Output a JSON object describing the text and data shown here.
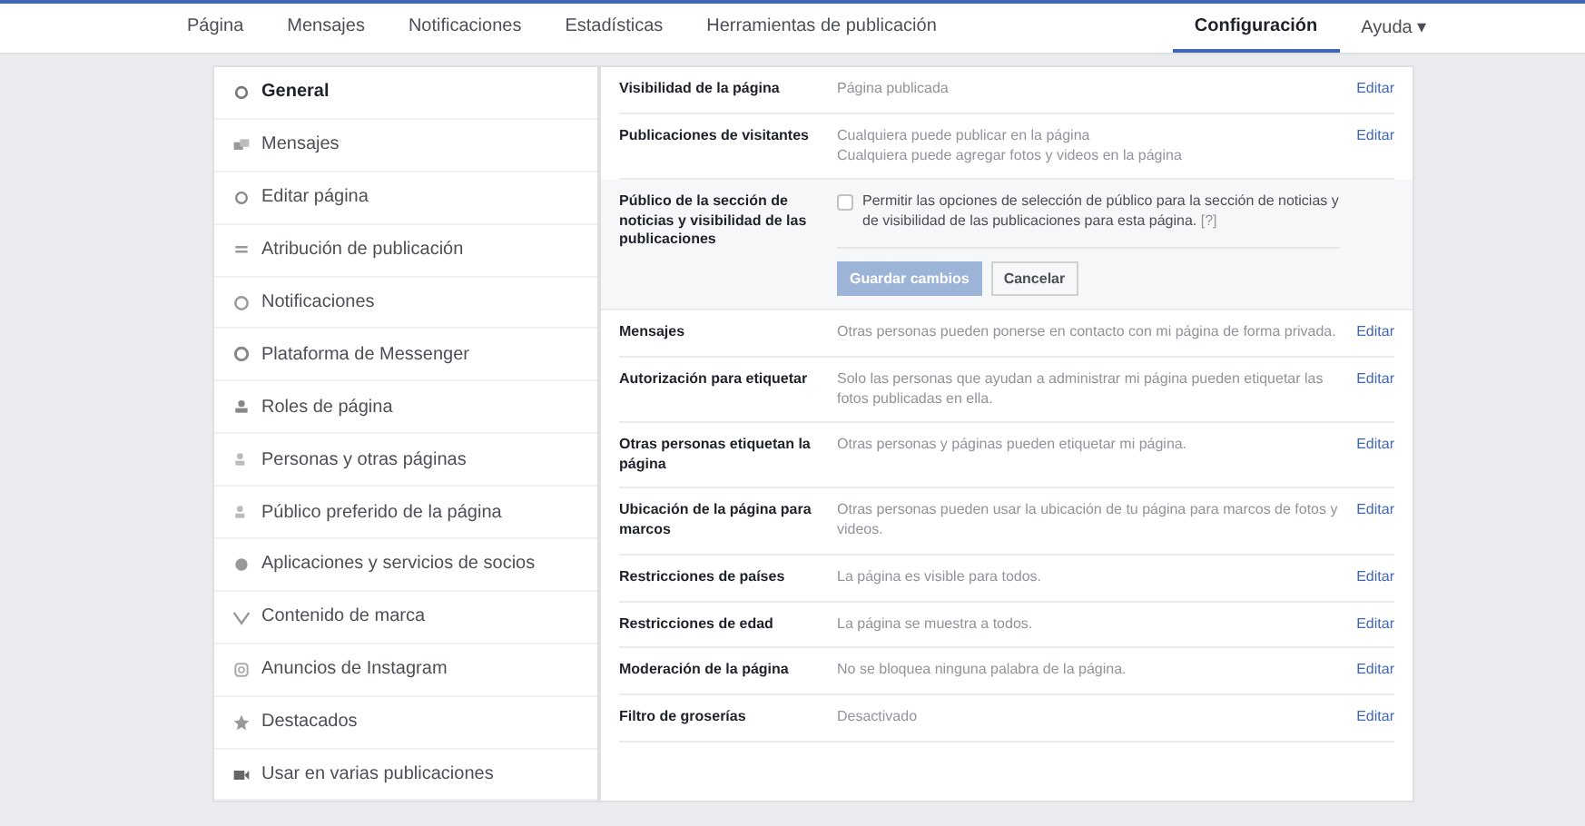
{
  "nav": {
    "tabs": [
      {
        "label": "Página",
        "selected": false
      },
      {
        "label": "Mensajes",
        "selected": false
      },
      {
        "label": "Notificaciones",
        "selected": false
      },
      {
        "label": "Estadísticas",
        "selected": false
      },
      {
        "label": "Herramientas de publicación",
        "selected": false
      },
      {
        "label": "Configuración",
        "selected": true
      },
      {
        "label": "Ayuda ▾",
        "selected": false
      }
    ]
  },
  "sidebar": {
    "items": [
      {
        "label": "General",
        "selected": true
      },
      {
        "label": "Mensajes",
        "selected": false
      },
      {
        "label": "Editar página",
        "selected": false
      },
      {
        "label": "Atribución de publicación",
        "selected": false
      },
      {
        "label": "Notificaciones",
        "selected": false
      },
      {
        "label": "Plataforma de Messenger",
        "selected": false
      },
      {
        "label": "Roles de página",
        "selected": false
      },
      {
        "label": "Personas y otras páginas",
        "selected": false
      },
      {
        "label": "Público preferido de la página",
        "selected": false
      },
      {
        "label": "Aplicaciones y servicios de socios",
        "selected": false
      },
      {
        "label": "Contenido de marca",
        "selected": false
      },
      {
        "label": "Anuncios de Instagram",
        "selected": false
      },
      {
        "label": "Destacados",
        "selected": false
      },
      {
        "label": "Usar en varias publicaciones",
        "selected": false
      }
    ]
  },
  "settings": [
    {
      "kind": "row",
      "label": "Visibilidad de la página",
      "lines": [
        "Página publicada"
      ],
      "action": "Editar"
    },
    {
      "kind": "row",
      "label": "Publicaciones de visitantes",
      "lines": [
        "Cualquiera puede publicar en la página",
        "Cualquiera puede agregar fotos y videos en la página"
      ],
      "action": "Editar"
    },
    {
      "kind": "form",
      "label": "Público de la sección de noticias y visibilidad de las publicaciones",
      "checkbox": {
        "label": "Permitir las opciones de selección de público para la sección de noticias y de visibilidad de las publicaciones para esta página.",
        "help": "[?]",
        "checked": false
      },
      "save": "Guardar cambios",
      "cancel": "Cancelar"
    },
    {
      "kind": "row",
      "label": "Mensajes",
      "lines": [
        "Otras personas pueden ponerse en contacto con mi página de forma privada."
      ],
      "action": "Editar"
    },
    {
      "kind": "row",
      "label": "Autorización para etiquetar",
      "lines": [
        "Solo las personas que ayudan a administrar mi página pueden etiquetar las fotos publicadas en ella."
      ],
      "action": "Editar"
    },
    {
      "kind": "row",
      "label": "Otras personas etiquetan la página",
      "lines": [
        "Otras personas y páginas pueden etiquetar mi página."
      ],
      "action": "Editar"
    },
    {
      "kind": "row",
      "label": "Ubicación de la página para marcos",
      "lines": [
        "Otras personas pueden usar la ubicación de tu página para marcos de fotos y videos."
      ],
      "action": "Editar"
    },
    {
      "kind": "row",
      "label": "Restricciones de países",
      "lines": [
        "La página es visible para todos."
      ],
      "action": "Editar"
    },
    {
      "kind": "row",
      "label": "Restricciones de edad",
      "lines": [
        "La página se muestra a todos."
      ],
      "action": "Editar"
    },
    {
      "kind": "row",
      "label": "Moderación de la página",
      "lines": [
        "No se bloquea ninguna palabra de la página."
      ],
      "action": "Editar"
    },
    {
      "kind": "row",
      "label": "Filtro de groserías",
      "lines": [
        "Desactivado"
      ],
      "action": "Editar"
    }
  ]
}
